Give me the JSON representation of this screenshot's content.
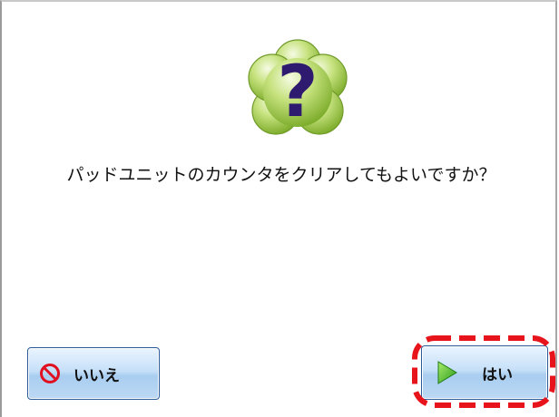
{
  "dialog": {
    "message": "パッドユニットのカウンタをクリアしてもよいですか？",
    "icon": "question-mark-icon"
  },
  "buttons": {
    "no_label": "いいえ",
    "no_icon": "prohibited-icon",
    "yes_label": "はい",
    "yes_icon": "play-arrow-icon"
  },
  "colors": {
    "icon_green": "#9ccc4a",
    "icon_question": "#2e1a6e",
    "highlight_red": "#e8141c",
    "button_border": "#2a5a9a"
  }
}
